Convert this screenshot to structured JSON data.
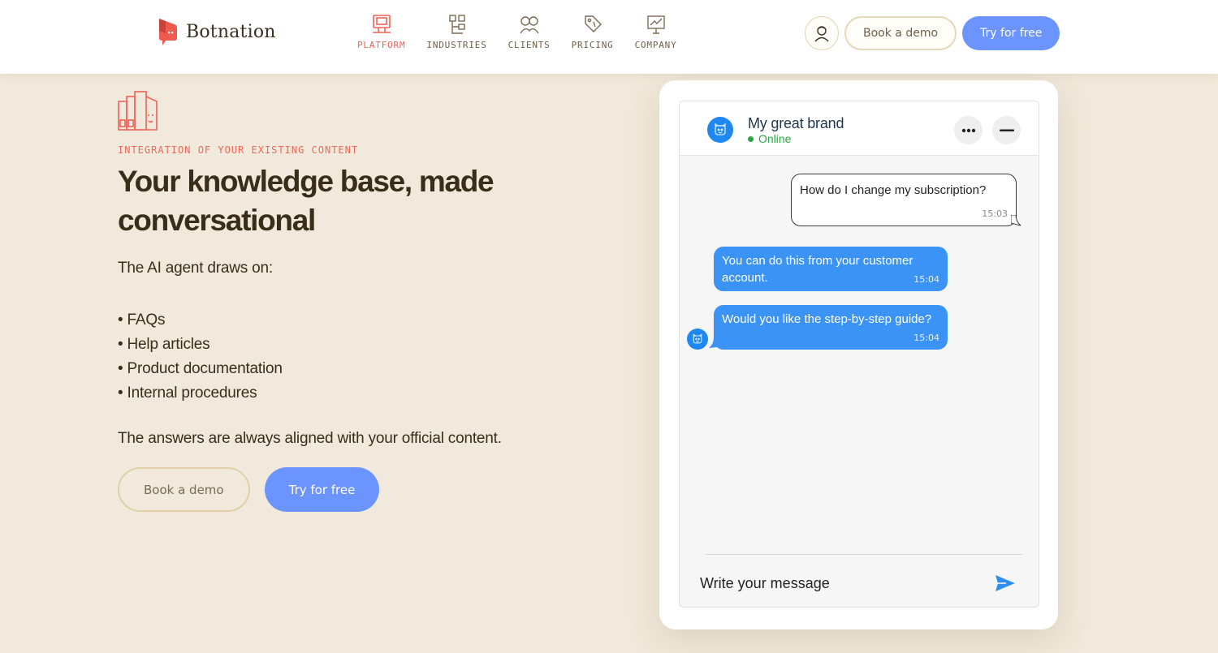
{
  "brand": {
    "name": "Botnation",
    "accent": "#ef6257",
    "blue": "#6c94ff"
  },
  "nav": {
    "items": [
      {
        "label": "PLATFORM",
        "icon": "computer-icon",
        "active": true
      },
      {
        "label": "INDUSTRIES",
        "icon": "building-icon",
        "active": false
      },
      {
        "label": "CLIENTS",
        "icon": "people-icon",
        "active": false
      },
      {
        "label": "PRICING",
        "icon": "price-tag-icon",
        "active": false
      },
      {
        "label": "COMPANY",
        "icon": "presentation-icon",
        "active": false
      }
    ]
  },
  "header": {
    "book_demo": "Book a demo",
    "try_free": "Try for free"
  },
  "hero": {
    "eyebrow": "INTEGRATION OF YOUR EXISTING CONTENT",
    "title": "Your knowledge base, made conversational",
    "intro": "The AI agent draws on:",
    "bullets": [
      "• FAQs",
      "• Help articles",
      "• Product documentation",
      "• Internal procedures"
    ],
    "closing": "The answers are always aligned with your official content.",
    "book_demo": "Book a demo",
    "try_free": "Try for free"
  },
  "chat": {
    "brand": "My great brand",
    "status": "Online",
    "messages": [
      {
        "from": "user",
        "text": "How do I change my subscription?",
        "time": "15:03"
      },
      {
        "from": "bot",
        "text": "You can do this from your customer account.",
        "time": "15:04"
      },
      {
        "from": "bot",
        "text": "Would you like the step-by-step guide?",
        "time": "15:04"
      }
    ],
    "placeholder": "Write your message"
  }
}
